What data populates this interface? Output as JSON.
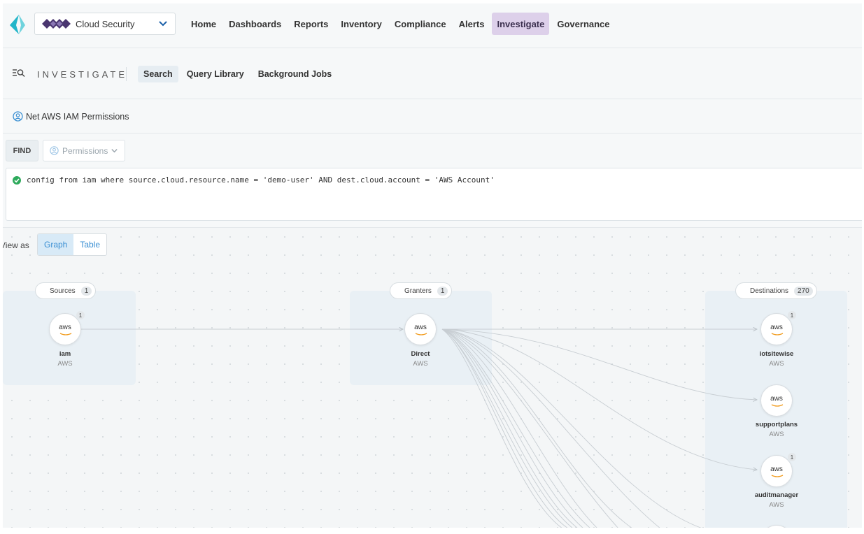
{
  "topnav": {
    "tenant_label": "Cloud Security",
    "links": [
      {
        "label": "Home",
        "active": false
      },
      {
        "label": "Dashboards",
        "active": false
      },
      {
        "label": "Reports",
        "active": false
      },
      {
        "label": "Inventory",
        "active": false
      },
      {
        "label": "Compliance",
        "active": false
      },
      {
        "label": "Alerts",
        "active": false
      },
      {
        "label": "Investigate",
        "active": true
      },
      {
        "label": "Governance",
        "active": false
      }
    ]
  },
  "subnav": {
    "title": "INVESTIGATE",
    "tabs": [
      {
        "label": "Search",
        "active": true
      },
      {
        "label": "Query Library",
        "active": false
      },
      {
        "label": "Background Jobs",
        "active": false
      }
    ]
  },
  "query": {
    "name": "Net AWS IAM Permissions",
    "find_label": "FIND",
    "type_label": "Permissions",
    "text": "config from iam where source.cloud.resource.name = 'demo-user' AND dest.cloud.account = 'AWS Account'"
  },
  "graph": {
    "view_as_label": "View as",
    "view_options": [
      {
        "label": "Graph",
        "active": true
      },
      {
        "label": "Table",
        "active": false
      }
    ],
    "groups": {
      "sources": {
        "label": "Sources",
        "count": "1"
      },
      "granters": {
        "label": "Granters",
        "count": "1"
      },
      "destinations": {
        "label": "Destinations",
        "count": "270"
      }
    },
    "nodes": {
      "iam": {
        "icon_text": "aws",
        "name": "iam",
        "provider": "AWS",
        "badge": "1"
      },
      "direct": {
        "icon_text": "aws",
        "name": "Direct",
        "provider": "AWS"
      },
      "iotsitewise": {
        "icon_text": "aws",
        "name": "iotsitewise",
        "provider": "AWS",
        "badge": "1"
      },
      "supportplans": {
        "icon_text": "aws",
        "name": "supportplans",
        "provider": "AWS"
      },
      "auditmanager": {
        "icon_text": "aws",
        "name": "auditmanager",
        "provider": "AWS",
        "badge": "1"
      }
    }
  },
  "colors": {
    "accent_purple": "#ddd0ea",
    "link_blue": "#3a8fd3",
    "success_green": "#2eaa5c",
    "logo_teal": "#22b5c9"
  }
}
